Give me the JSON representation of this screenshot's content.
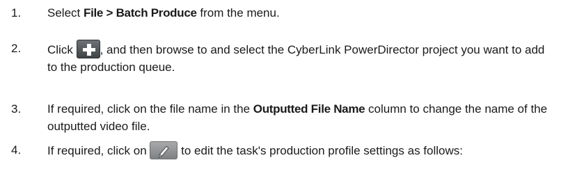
{
  "steps": [
    {
      "number": "1.",
      "pre": "Select ",
      "bold1": "File",
      "mid": " > ",
      "bold2": "Batch Produce",
      "post": " from the menu."
    },
    {
      "number": "2.",
      "pre": "Click ",
      "icon": "add-plus-icon",
      "post": ", and then browse to and select the CyberLink PowerDirector project you want to add to the production queue."
    },
    {
      "number": "3.",
      "pre": "If required, click on the file name in the ",
      "bold": "Outputted File Name",
      "post": " column to change the name of the outputted video file."
    },
    {
      "number": "4.",
      "pre": "If required, click on ",
      "icon": "edit-pencil-icon",
      "post": " to edit the task's production profile settings as follows:"
    }
  ]
}
